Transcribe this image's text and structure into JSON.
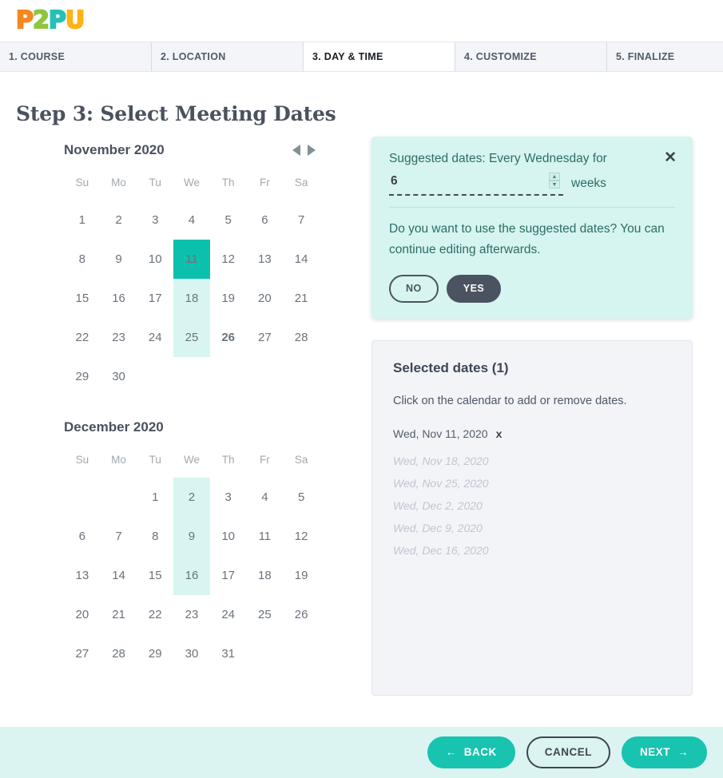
{
  "brand": {
    "logo_letters": [
      "P",
      "2",
      "P",
      "U"
    ],
    "colors": {
      "orange": "#f5871f",
      "green": "#8ec63f",
      "teal": "#27c0b6",
      "yellow": "#fcb316",
      "accent": "#18c3b0",
      "selected_cell": "#0bc1ad",
      "suggested_cell": "#d9f5f2",
      "popup_bg": "#d6f4f0",
      "footer_bg": "#dcf4f1",
      "holiday": "#f5821f"
    }
  },
  "tabs": [
    {
      "label": "1. COURSE",
      "active": false
    },
    {
      "label": "2. LOCATION",
      "active": false
    },
    {
      "label": "3. DAY & TIME",
      "active": true
    },
    {
      "label": "4. CUSTOMIZE",
      "active": false
    },
    {
      "label": "5. FINALIZE",
      "active": false
    }
  ],
  "page": {
    "title": "Step 3: Select Meeting Dates"
  },
  "calendars": [
    {
      "title": "November 2020",
      "weekdays": [
        "Su",
        "Mo",
        "Tu",
        "We",
        "Th",
        "Fr",
        "Sa"
      ],
      "weeks": [
        [
          {
            "d": ""
          },
          {
            "d": "1"
          },
          {
            "d": "2"
          },
          {
            "d": "3"
          },
          {
            "d": "4"
          },
          {
            "d": "5"
          },
          {
            "d": "6"
          }
        ],
        [
          {
            "d": "7"
          }
        ]
      ],
      "grid": [
        [
          {
            "d": "1"
          },
          {
            "d": "2"
          },
          {
            "d": "3"
          },
          {
            "d": "4"
          },
          {
            "d": "5"
          },
          {
            "d": "6"
          },
          {
            "d": "7"
          }
        ],
        [
          {
            "d": "8"
          },
          {
            "d": "9"
          },
          {
            "d": "10"
          },
          {
            "d": "11",
            "state": "selected"
          },
          {
            "d": "12"
          },
          {
            "d": "13"
          },
          {
            "d": "14"
          }
        ],
        [
          {
            "d": "15"
          },
          {
            "d": "16"
          },
          {
            "d": "17"
          },
          {
            "d": "18",
            "state": "suggested"
          },
          {
            "d": "19"
          },
          {
            "d": "20"
          },
          {
            "d": "21"
          }
        ],
        [
          {
            "d": "22"
          },
          {
            "d": "23"
          },
          {
            "d": "24"
          },
          {
            "d": "25",
            "state": "suggested"
          },
          {
            "d": "26",
            "state": "holiday"
          },
          {
            "d": "27"
          },
          {
            "d": "28"
          }
        ],
        [
          {
            "d": "29"
          },
          {
            "d": "30"
          },
          {
            "d": ""
          },
          {
            "d": ""
          },
          {
            "d": ""
          },
          {
            "d": ""
          },
          {
            "d": ""
          }
        ]
      ],
      "nav": {
        "prev": "previous-month",
        "next": "next-month"
      }
    },
    {
      "title": "December 2020",
      "weekdays": [
        "Su",
        "Mo",
        "Tu",
        "We",
        "Th",
        "Fr",
        "Sa"
      ],
      "grid": [
        [
          {
            "d": ""
          },
          {
            "d": ""
          },
          {
            "d": "1"
          },
          {
            "d": "2",
            "state": "suggested"
          },
          {
            "d": "3"
          },
          {
            "d": "4"
          },
          {
            "d": "5"
          }
        ],
        [
          {
            "d": "6"
          },
          {
            "d": "7"
          },
          {
            "d": "8"
          },
          {
            "d": "9",
            "state": "suggested"
          },
          {
            "d": "10"
          },
          {
            "d": "11"
          },
          {
            "d": "12"
          }
        ],
        [
          {
            "d": "13"
          },
          {
            "d": "14"
          },
          {
            "d": "15"
          },
          {
            "d": "16",
            "state": "suggested"
          },
          {
            "d": "17"
          },
          {
            "d": "18"
          },
          {
            "d": "19"
          }
        ],
        [
          {
            "d": "20"
          },
          {
            "d": "21"
          },
          {
            "d": "22"
          },
          {
            "d": "23"
          },
          {
            "d": "24"
          },
          {
            "d": "25"
          },
          {
            "d": "26"
          }
        ],
        [
          {
            "d": "27"
          },
          {
            "d": "28"
          },
          {
            "d": "29"
          },
          {
            "d": "30"
          },
          {
            "d": "31"
          },
          {
            "d": ""
          },
          {
            "d": ""
          }
        ]
      ]
    }
  ],
  "popup": {
    "headline": "Suggested dates: Every Wednesday for",
    "weeks_value": "6",
    "weeks_placeholder": "",
    "weeks_unit": "weeks",
    "question": "Do you want to use the suggested dates? You can continue editing afterwards.",
    "no_label": "NO",
    "yes_label": "YES",
    "close_glyph": "✕"
  },
  "selected_panel": {
    "title": "Selected dates (1)",
    "hint": "Click on the calendar to add or remove dates.",
    "dates": [
      {
        "label": "Wed, Nov 11, 2020",
        "remove": "x",
        "ghost": false
      },
      {
        "label": "Wed, Nov 18, 2020",
        "ghost": true
      },
      {
        "label": "Wed, Nov 25, 2020",
        "ghost": true
      },
      {
        "label": "Wed, Dec 2, 2020",
        "ghost": true
      },
      {
        "label": "Wed, Dec 9, 2020",
        "ghost": true
      },
      {
        "label": "Wed, Dec 16, 2020",
        "ghost": true
      }
    ]
  },
  "footer": {
    "back_label": "BACK",
    "cancel_label": "CANCEL",
    "next_label": "NEXT",
    "back_arrow": "←",
    "next_arrow": "→"
  }
}
